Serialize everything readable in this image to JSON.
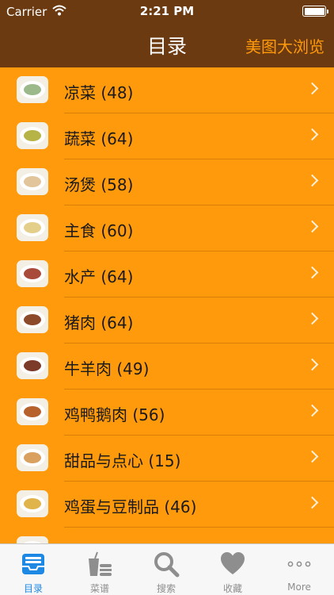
{
  "status_bar": {
    "carrier": "Carrier",
    "time": "2:21 PM"
  },
  "nav": {
    "title": "目录",
    "right_button": "美图大浏览"
  },
  "list": {
    "items": [
      {
        "label": "凉菜 (48)",
        "food_color": "#9bb98a"
      },
      {
        "label": "蔬菜 (64)",
        "food_color": "#b6b447"
      },
      {
        "label": "汤煲 (58)",
        "food_color": "#e2c59a"
      },
      {
        "label": "主食 (60)",
        "food_color": "#e4cf8a"
      },
      {
        "label": "水产 (64)",
        "food_color": "#a84b3a"
      },
      {
        "label": "猪肉 (64)",
        "food_color": "#8c4a2a"
      },
      {
        "label": "牛羊肉 (49)",
        "food_color": "#7b3b28"
      },
      {
        "label": "鸡鸭鹅肉 (56)",
        "food_color": "#b7622d"
      },
      {
        "label": "甜品与点心 (15)",
        "food_color": "#d9a060"
      },
      {
        "label": "鸡蛋与豆制品 (46)",
        "food_color": "#e0b44a"
      }
    ]
  },
  "tabbar": {
    "tabs": [
      {
        "label": "目录",
        "icon": "inbox-tray-icon",
        "active": true
      },
      {
        "label": "菜谱",
        "icon": "cup-and-food-icon",
        "active": false
      },
      {
        "label": "搜索",
        "icon": "search-icon",
        "active": false
      },
      {
        "label": "收藏",
        "icon": "heart-icon",
        "active": false
      },
      {
        "label": "More",
        "icon": "more-dots-icon",
        "active": false
      }
    ]
  },
  "colors": {
    "nav_background": "#6B3A10",
    "list_background": "#FF9A0C",
    "accent_blue": "#1E88E5",
    "nav_right_text": "#FF9A0C"
  }
}
